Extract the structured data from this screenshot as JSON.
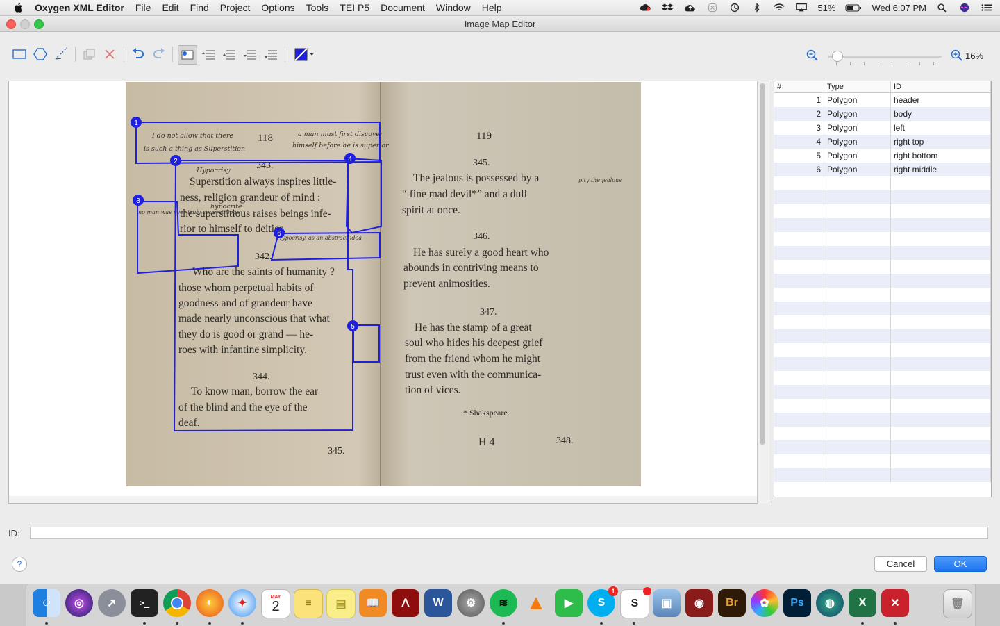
{
  "menubar": {
    "app_name": "Oxygen XML Editor",
    "items": [
      "File",
      "Edit",
      "Find",
      "Project",
      "Options",
      "Tools",
      "TEI P5",
      "Document",
      "Window",
      "Help"
    ],
    "battery": "51%",
    "clock": "Wed 6:07 PM"
  },
  "window": {
    "title": "Image Map Editor"
  },
  "toolbar": {
    "tools": [
      "rectangle-icon",
      "polygon-icon",
      "freehand-icon",
      "duplicate-icon",
      "delete-icon",
      "undo-icon",
      "redo-icon",
      "show-labels-icon",
      "bring-to-front-icon",
      "bring-forward-icon",
      "send-backward-icon",
      "send-to-back-icon",
      "color-icon"
    ]
  },
  "zoom": {
    "value": "16%"
  },
  "page_image": {
    "page_numbers": [
      "118",
      "119"
    ],
    "left_page_text": [
      "343.",
      "Superstition always inspires little-",
      "ness, religion grandeur of mind :",
      "the superstitious raises beings infe-",
      "rior to himself to deities.",
      "342.",
      "Who are the saints of humanity ?",
      "those whom perpetual habits of",
      "goodness and of grandeur have",
      "made nearly unconscious that what",
      "they do is good or grand — he-",
      "roes with infantine simplicity.",
      "344.",
      "To know man, borrow the ear",
      "of the blind and the eye of the",
      "deaf.",
      "345."
    ],
    "right_page_text": [
      "345.",
      "The jealous is possessed by a",
      "“ fine mad devil*” and a dull",
      "spirit at once.",
      "346.",
      "He has surely a good heart who",
      "abounds in contriving means to",
      "prevent animosities.",
      "347.",
      "He has the stamp of a great",
      "soul who hides his deepest grief",
      "from the friend whom he might",
      "trust even with the communica-",
      "tion of vices.",
      "* Shakspeare.",
      "H 4",
      "348."
    ],
    "handwriting": [
      "I do not allow that there",
      "is such a thing as Superstition",
      "a man must first discover",
      "himself before he is superior",
      "Hypocrisy",
      "hypocrite",
      "no man was ever truly superstitious",
      "Hypocrisy, as an abstract idea",
      "pity the jealous"
    ]
  },
  "areas": {
    "headers": {
      "num": "#",
      "type": "Type",
      "id": "ID"
    },
    "rows": [
      {
        "num": "1",
        "type": "Polygon",
        "id": "header"
      },
      {
        "num": "2",
        "type": "Polygon",
        "id": "body"
      },
      {
        "num": "3",
        "type": "Polygon",
        "id": "left"
      },
      {
        "num": "4",
        "type": "Polygon",
        "id": "right top"
      },
      {
        "num": "5",
        "type": "Polygon",
        "id": "right bottom"
      },
      {
        "num": "6",
        "type": "Polygon",
        "id": "right middle"
      }
    ],
    "marker_labels": [
      "1",
      "2",
      "3",
      "4",
      "5",
      "6"
    ]
  },
  "form": {
    "id_label": "ID:",
    "id_value": "",
    "help": "?",
    "cancel": "Cancel",
    "ok": "OK"
  },
  "colors": {
    "selection": "#1f1fe0",
    "ok_button": "#1a74ef",
    "paper": "#cfc6b4"
  },
  "dock": {
    "apps": [
      "Finder",
      "Siri",
      "Launchpad",
      "Terminal",
      "Chrome",
      "Firefox",
      "Safari",
      "Calendar",
      "Notes",
      "Stickies",
      "Books",
      "Acrobat",
      "Word",
      "System Preferences",
      "Spotify",
      "VLC",
      "FaceTime",
      "Skype",
      "Skitch",
      "Preview",
      "Photo Booth",
      "Bridge",
      "Photos",
      "Photoshop",
      "Globe",
      "Excel",
      "Oxygen",
      "Trash"
    ],
    "calendar_month": "MAY",
    "calendar_day": "2",
    "skype_badge": "1",
    "bridge_label": "Br",
    "photoshop_label": "Ps"
  }
}
